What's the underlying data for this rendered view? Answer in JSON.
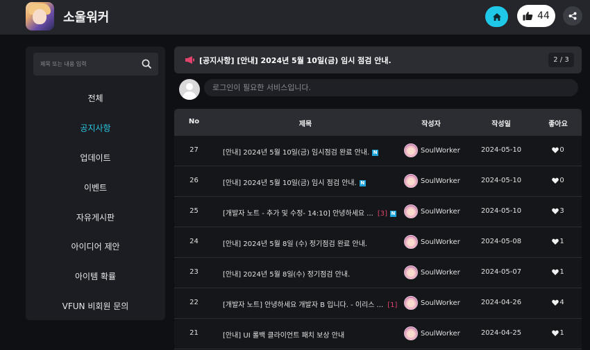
{
  "app": {
    "title": "소울워커",
    "like_count": "44"
  },
  "search": {
    "placeholder": "제목 또는 내용 입력"
  },
  "sidebar": {
    "items": [
      {
        "label": "전체"
      },
      {
        "label": "공지사항"
      },
      {
        "label": "업데이트"
      },
      {
        "label": "이벤트"
      },
      {
        "label": "자유게시판"
      },
      {
        "label": "아이디어 제안"
      },
      {
        "label": "아이템 확률"
      },
      {
        "label": "VFUN 비회원 문의"
      }
    ],
    "active_index": 1
  },
  "notice": {
    "text": "[공지사항] [안내] 2024년 5월 10일(금) 임시 점검 안내.",
    "pager": "2 / 3"
  },
  "comment": {
    "login_prompt": "로그인이 필요한 서비스입니다."
  },
  "table": {
    "headers": {
      "no": "No",
      "title": "제목",
      "author": "작성자",
      "date": "작성일",
      "likes": "좋아요"
    },
    "rows": [
      {
        "no": "27",
        "title": "[안내] 2024년 5월 10일(금) 임시점검 완료 안내.",
        "comments": "",
        "new": "N",
        "author": "SoulWorker",
        "date": "2024-05-10",
        "likes": "0"
      },
      {
        "no": "26",
        "title": "[안내] 2024년 5월 10일(금) 임시 점검 안내.",
        "comments": "",
        "new": "N",
        "author": "SoulWorker",
        "date": "2024-05-10",
        "likes": "0"
      },
      {
        "no": "25",
        "title": "[개발자 노트 - 추가 및 수정- 14:10] 안녕하세요 ...",
        "comments": "[3]",
        "new": "N",
        "author": "SoulWorker",
        "date": "2024-05-10",
        "likes": "3"
      },
      {
        "no": "24",
        "title": "[안내] 2024년 5월 8일 (수) 정기점검 완료 안내.",
        "comments": "",
        "new": "",
        "author": "SoulWorker",
        "date": "2024-05-08",
        "likes": "1"
      },
      {
        "no": "23",
        "title": "[안내] 2024년 5월 8일(수) 정기점검 안내.",
        "comments": "",
        "new": "",
        "author": "SoulWorker",
        "date": "2024-05-07",
        "likes": "1"
      },
      {
        "no": "22",
        "title": "[개발자 노트] 안녕하세요 개발자 B 입니다. - 이리스 ...",
        "comments": "[1]",
        "new": "",
        "author": "SoulWorker",
        "date": "2024-04-26",
        "likes": "4"
      },
      {
        "no": "21",
        "title": "[안내] UI 롤백 클라이언트 패치 보상 안내",
        "comments": "",
        "new": "",
        "author": "SoulWorker",
        "date": "2024-04-25",
        "likes": "1"
      }
    ]
  },
  "colors": {
    "accent": "#2bc6e0",
    "comment_count": "#e0446c",
    "new_badge": "#1ea4d8"
  }
}
